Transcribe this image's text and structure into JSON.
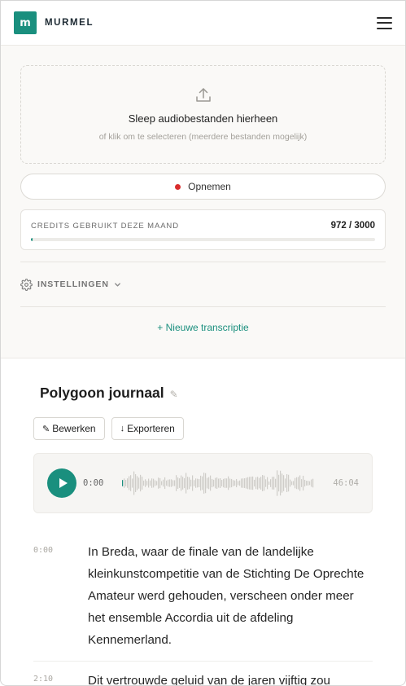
{
  "header": {
    "logo_letter": "m",
    "brand": "MURMEL"
  },
  "upload": {
    "title": "Sleep audiobestanden hierheen",
    "subtitle": "of klik om te selecteren (meerdere bestanden mogelijk)"
  },
  "record": {
    "label": "Opnemen"
  },
  "credits": {
    "label": "CREDITS GEBRUIKT DEZE MAAND",
    "value": "972 / 3000",
    "used": 972,
    "total": 3000
  },
  "settings": {
    "label": "INSTELLINGEN"
  },
  "new_transcript": {
    "label": "+ Nieuwe transcriptie"
  },
  "transcript": {
    "title": "Polygoon journaal",
    "edit_label": "Bewerken",
    "export_label": "Exporteren",
    "player": {
      "current": "0:00",
      "duration": "46:04",
      "progress": 0
    },
    "segments": [
      {
        "time": "0:00",
        "text": "In Breda, waar de finale van de landelijke kleinkunstcompetitie van de Stichting De Oprechte Amateur werd gehouden, verscheen onder meer het ensemble Accordia uit de afdeling Kennemerland."
      },
      {
        "time": "2:10",
        "text": "Dit vertrouwde geluid van de jaren vijftig zou"
      }
    ]
  },
  "colors": {
    "accent": "#1a8f7e",
    "record": "#d92c2c"
  }
}
